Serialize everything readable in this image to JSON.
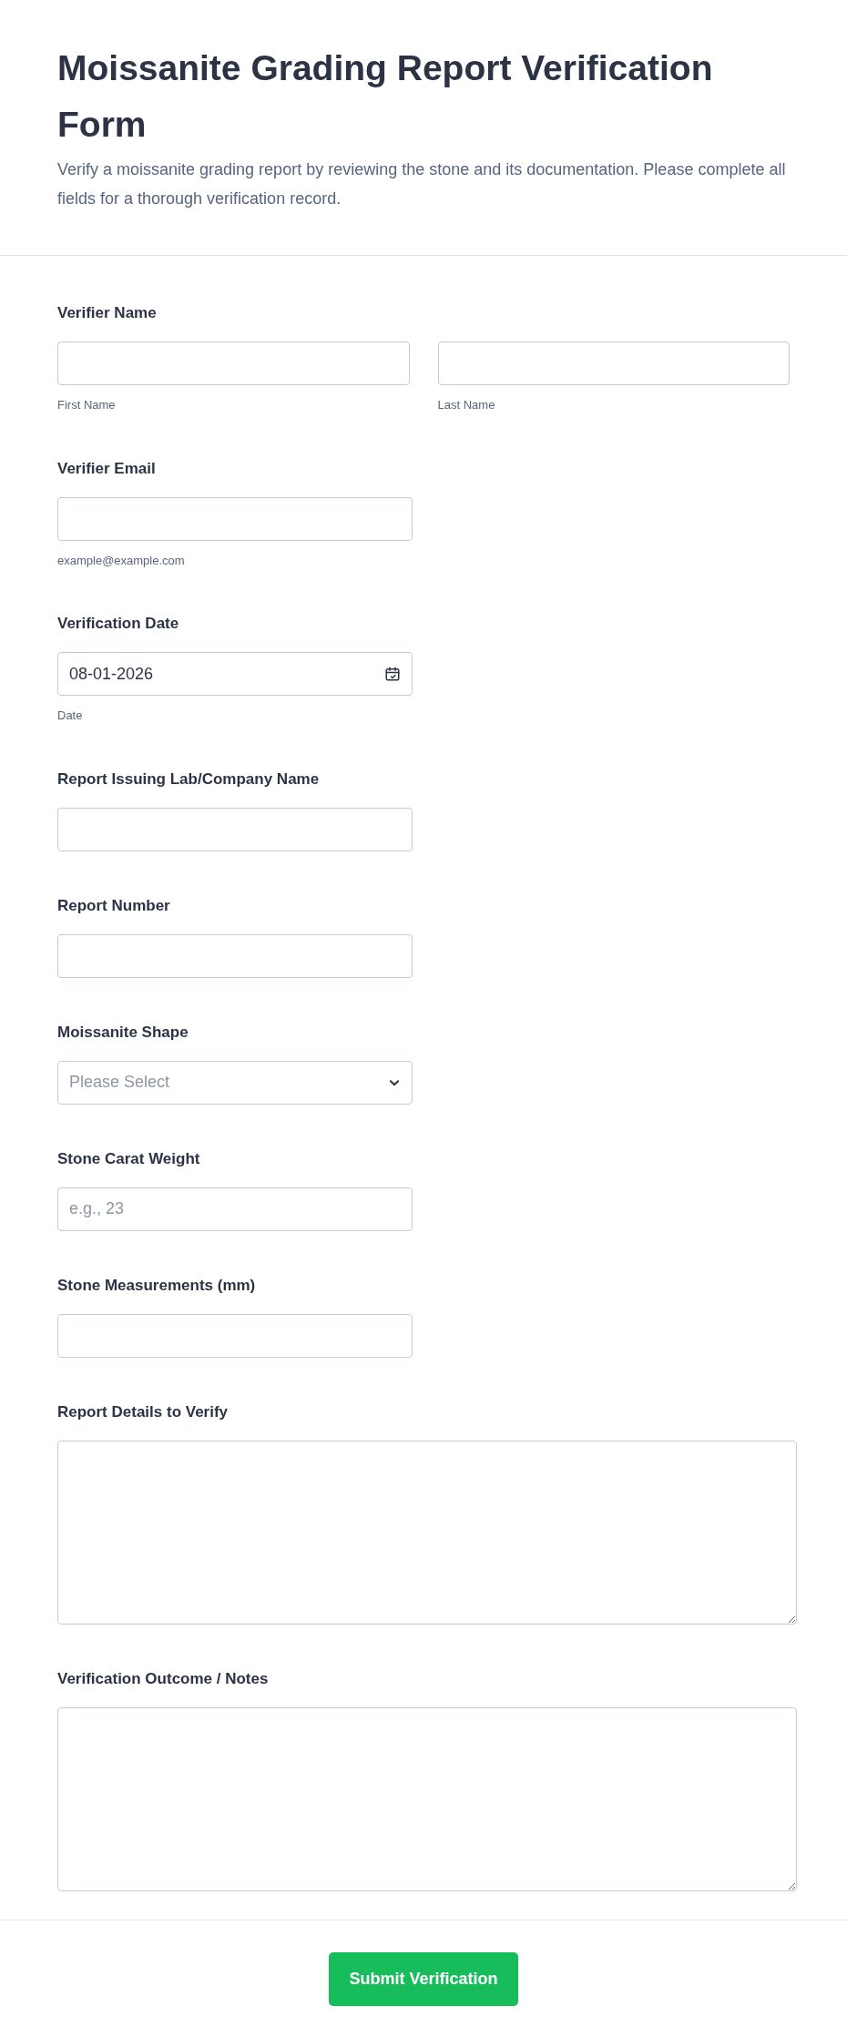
{
  "header": {
    "title": "Moissanite Grading Report Verification Form",
    "description": "Verify a moissanite grading report by reviewing the stone and its documentation. Please complete all fields for a thorough verification record."
  },
  "fields": [
    {
      "kind": "name",
      "label": "Verifier Name",
      "parts": [
        {
          "sublabel": "First Name"
        },
        {
          "sublabel": "Last Name"
        }
      ]
    },
    {
      "kind": "text",
      "label": "Verifier Email",
      "sublabel": "example@example.com"
    },
    {
      "kind": "date",
      "label": "Verification Date",
      "value": "08-01-2026",
      "sublabel": "Date"
    },
    {
      "kind": "text",
      "label": "Report Issuing Lab/Company Name"
    },
    {
      "kind": "text",
      "label": "Report Number"
    },
    {
      "kind": "select",
      "label": "Moissanite Shape",
      "placeholder": "Please Select"
    },
    {
      "kind": "text",
      "label": "Stone Carat Weight",
      "placeholder": "e.g., 23"
    },
    {
      "kind": "text",
      "label": "Stone Measurements (mm)"
    },
    {
      "kind": "textarea",
      "label": "Report Details to Verify"
    },
    {
      "kind": "textarea",
      "label": "Verification Outcome / Notes"
    }
  ],
  "submit": {
    "label": "Submit Verification"
  }
}
